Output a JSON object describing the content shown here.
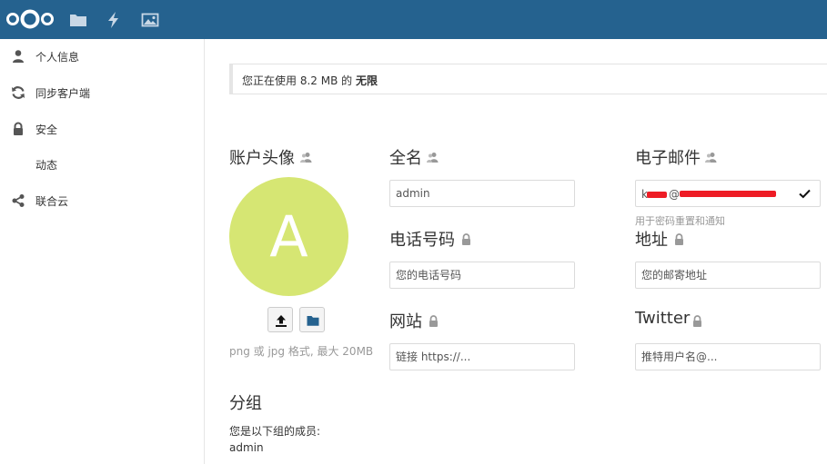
{
  "header": {
    "icons": [
      "nextcloud-logo",
      "files-icon",
      "activity-icon",
      "gallery-icon"
    ],
    "bg_color": "#25628f"
  },
  "sidebar": {
    "items": [
      {
        "label": "个人信息",
        "icon": "person-icon"
      },
      {
        "label": "同步客户端",
        "icon": "sync-icon"
      },
      {
        "label": "安全",
        "icon": "lock-icon"
      },
      {
        "label": "动态",
        "icon": ""
      },
      {
        "label": "联合云",
        "icon": "share-icon"
      }
    ]
  },
  "quota": {
    "prefix": "您正在使用 8.2 MB 的",
    "limit": "无限"
  },
  "avatar": {
    "title": "账户头像",
    "letter": "A",
    "color": "#d6e673",
    "hint": "png 或 jpg 格式, 最大 20MB"
  },
  "fullname": {
    "title": "全名",
    "value": "admin"
  },
  "email": {
    "title": "电子邮件",
    "value": "k",
    "hint": "用于密码重置和通知"
  },
  "phone": {
    "title": "电话号码",
    "placeholder": "您的电话号码"
  },
  "address": {
    "title": "地址",
    "placeholder": "您的邮寄地址"
  },
  "website": {
    "title": "网站",
    "placeholder": "链接 https://..."
  },
  "twitter": {
    "title": "Twitter",
    "placeholder": "推特用户名@..."
  },
  "groups": {
    "title": "分组",
    "member_of": "您是以下组的成员:",
    "list": "admin"
  }
}
